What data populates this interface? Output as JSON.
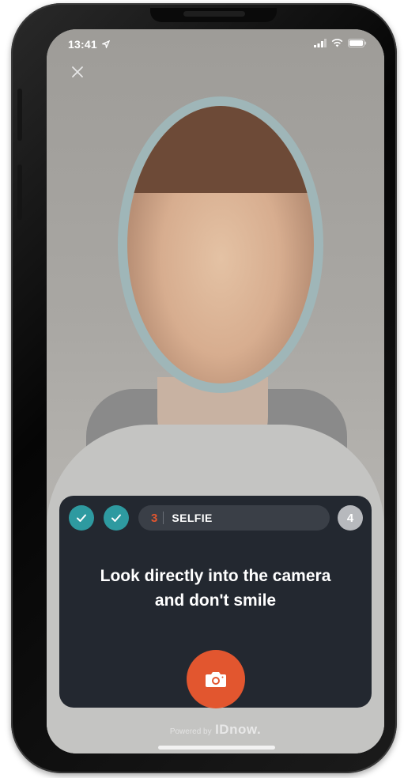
{
  "status_bar": {
    "time": "13:41",
    "location_icon": "location-arrow-icon",
    "signal_icon": "cellular-signal-icon",
    "wifi_icon": "wifi-icon",
    "battery_icon": "battery-icon"
  },
  "camera_view": {
    "close_icon": "close-icon",
    "overlay_color": "#9fb6b8"
  },
  "steps": {
    "completed_icon": "checkmark-icon",
    "completed_color": "#2e9aa0",
    "current_number": "3",
    "current_label": "SELFIE",
    "next_number": "4"
  },
  "instruction": {
    "line1": "Look directly into the camera",
    "line2": "and don't smile"
  },
  "capture": {
    "icon": "camera-icon",
    "color": "#e2562f"
  },
  "footer": {
    "powered_by": "Powered by",
    "brand": "IDnow."
  }
}
